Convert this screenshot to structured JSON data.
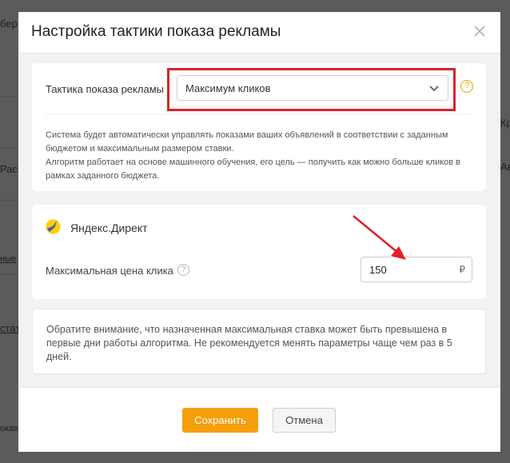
{
  "background": {
    "fragments": [
      "бер",
      "Рас",
      "ные",
      "стат",
      "оках",
      "Кр",
      "Ав"
    ]
  },
  "modal": {
    "title": "Настройка тактики показа рекламы",
    "close_icon": "close-icon"
  },
  "tactic": {
    "label": "Тактика показа рекламы",
    "selected": "Максимум кликов",
    "help_mark": "?",
    "description_1": "Система будет автоматически управлять показами ваших объявлений в соответствии с заданным бюджетом и максимальным размером ставки.",
    "description_2": "Алгоритм работает на основе машинного обучения, его цель — получить как можно больше кликов в рамках заданного бюджета."
  },
  "platform": {
    "name": "Яндекс.Директ",
    "icon": "yandex-direct-icon",
    "max_price_label": "Максимальная цена клика",
    "help_mark": "?",
    "max_price_value": "150",
    "currency": "₽"
  },
  "notice": {
    "text": "Обратите внимание, что назначенная максимальная ставка может быть превышена в первые дни работы алгоритма. Не рекомендуется менять параметры чаще чем раз в 5 дней."
  },
  "footer": {
    "save_label": "Сохранить",
    "cancel_label": "Отмена"
  },
  "colors": {
    "accent": "#f59f0c",
    "highlight": "#e0212b",
    "help": "#e9a100"
  }
}
